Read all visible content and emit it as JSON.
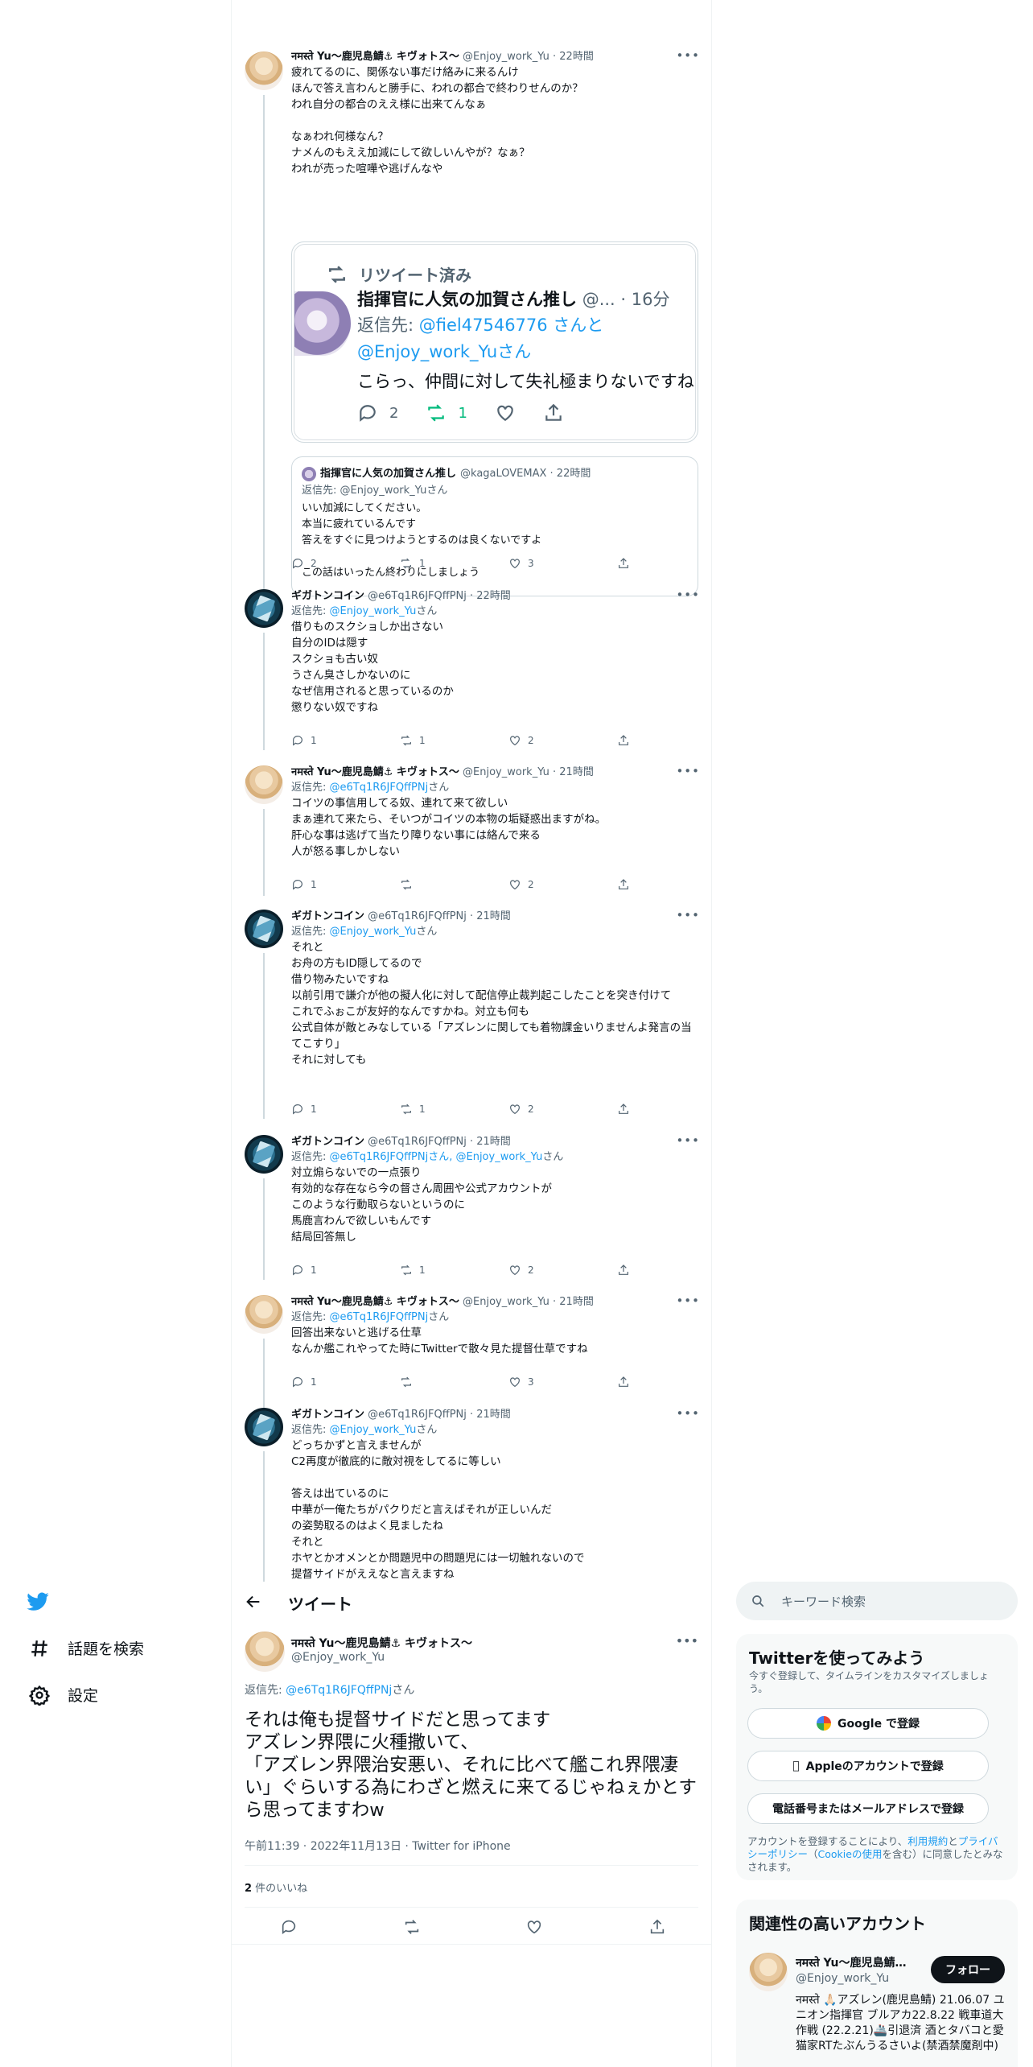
{
  "timeline": {
    "tweet1": {
      "name": "नमस्ते Yu〜鹿児島鯖⚓ キヴォトス〜",
      "handle": "@Enjoy_work_Yu · 22時間",
      "text": "疲れてるのに、関係ない事だけ絡みに来るんけ\nほんで答え言わんと勝手に、われの都合で終わりせんのか？\nわれ自分の都合のええ様に出来てんなぁ\n\nなぁわれ何様なん？\nナメんのもええ加減にして欲しいんやが？なぁ？\nわれが売った喧嘩や逃げんなや",
      "embed": {
        "retweet_label": "リツイート済み",
        "name": "指揮官に人気の加賀さん推し",
        "meta": "@... · 16分",
        "reply_to": "返信先: @fiel47546776 さんと @Enjoy_work_Yuさん",
        "reply_to_a": "返信先: ",
        "reply_to_b": "@fiel47546776 さんと @Enjoy_work_Yuさん",
        "text": "こらっ、仲間に対して失礼極まりないですね",
        "replies": "2",
        "retweets": "1"
      },
      "quote": {
        "name": "指揮官に人気の加賀さん推し",
        "handle": "@kagaLOVEMAX · 22時間",
        "reply_to": "返信先: @Enjoy_work_Yuさん",
        "text": "いい加減にしてください。\n本当に疲れているんです\n答えをすぐに見つけようとするのは良くないですよ\n\nこの話はいったん終わりにしましょう"
      },
      "replies": "2",
      "retweets": "1",
      "likes": "3"
    },
    "tweet2": {
      "name": "ギガトンコイン",
      "handle": "@e6Tq1R6JFQffPNj · 22時間",
      "reply_to_prefix": "返信先: ",
      "reply_to_link": "@Enjoy_work_Yu",
      "reply_to_suffix": "さん",
      "text": "借りものスクショしか出さない\n自分のIDは隠す\nスクショも古い奴\nうさん臭さしかないのに\nなぜ信用されると思っているのか\n懲りない奴ですね",
      "replies": "1",
      "retweets": "1",
      "likes": "2"
    },
    "tweet3": {
      "name": "नमस्ते Yu〜鹿児島鯖⚓ キヴォトス〜",
      "handle": "@Enjoy_work_Yu · 21時間",
      "reply_to_prefix": "返信先: ",
      "reply_to_link": "@e6Tq1R6JFQffPNj",
      "reply_to_suffix": "さん",
      "text": "コイツの事信用してる奴、連れて来て欲しい\nまぁ連れて来たら、そいつがコイツの本物の垢疑惑出ますがね。\n肝心な事は逃げて当たり障りない事には絡んで来る\n人が怒る事しかしない",
      "replies": "1",
      "retweets": "",
      "likes": "2"
    },
    "tweet4": {
      "name": "ギガトンコイン",
      "handle": "@e6Tq1R6JFQffPNj · 21時間",
      "reply_to_prefix": "返信先: ",
      "reply_to_link": "@Enjoy_work_Yu",
      "reply_to_suffix": "さん",
      "text": "それと\nお舟の方もID隠してるので\n借り物みたいですね\n以前引用で謙介が他の擬人化に対して配信停止裁判起こしたことを突き付けて\nこれでふぉこが友好的なんですかね。対立も何も\n公式自体が敵とみなしている「アズレンに関しても着物課金いりませんよ発言の当てこすり」\nそれに対しても",
      "replies": "1",
      "retweets": "1",
      "likes": "2"
    },
    "tweet5": {
      "name": "ギガトンコイン",
      "handle": "@e6Tq1R6JFQffPNj · 21時間",
      "reply_to_prefix": "返信先: ",
      "reply_to_link": "@e6Tq1R6JFQffPNjさん, @Enjoy_work_Yu",
      "reply_to_suffix": "さん",
      "text": "対立煽らないでの一点張り\n有効的な存在なら今の督さん周囲や公式アカウントが\nこのような行動取らないというのに\n馬鹿言わんで欲しいもんです\n結局回答無し",
      "replies": "1",
      "retweets": "1",
      "likes": "2"
    },
    "tweet6": {
      "name": "नमस्ते Yu〜鹿児島鯖⚓ キヴォトス〜",
      "handle": "@Enjoy_work_Yu · 21時間",
      "reply_to_prefix": "返信先: ",
      "reply_to_link": "@e6Tq1R6JFQffPNj",
      "reply_to_suffix": "さん",
      "text": "回答出来ないと逃げる仕草\nなんか艦これやってた時にTwitterで散々見た提督仕草ですね",
      "replies": "1",
      "retweets": "",
      "likes": "3"
    },
    "tweet7": {
      "name": "ギガトンコイン",
      "handle": "@e6Tq1R6JFQffPNj · 21時間",
      "reply_to_prefix": "返信先: ",
      "reply_to_link": "@Enjoy_work_Yu",
      "reply_to_suffix": "さん",
      "text": "どっちかずと言えませんが\nC2再度が徹底的に敵対視をしてるに等しい\n\n答えは出ているのに\n中華が一俺たちがパクりだと言えばそれが正しいんだ\nの姿勢取るのはよく見ましたね\nそれと\nホヤとかオメンとか問題児中の問題児には一切触れないので\n提督サイドがええなと言えますね"
    }
  },
  "nav": {
    "explore": "話題を検索",
    "settings": "設定"
  },
  "focus": {
    "title": "ツイート",
    "name": "नमस्ते Yu〜鹿児島鯖⚓ キヴォトス〜",
    "handle": "@Enjoy_work_Yu",
    "reply_to_prefix": "返信先: ",
    "reply_to_link": "@e6Tq1R6JFQffPNj",
    "reply_to_suffix": "さん",
    "text": "それは俺も提督サイドだと思ってます\nアズレン界隈に火種撒いて、\n「アズレン界隈治安悪い、それに比べて艦これ界隈凄い」ぐらいする為にわざと燃えに来てるじゃねぇかとすら思ってますわw",
    "meta": "午前11:39 · 2022年11月13日 · Twitter for iPhone",
    "likes_count": "2",
    "likes_label": " 件のいいね"
  },
  "sidebar": {
    "search_placeholder": "キーワード検索",
    "signup": {
      "title": "Twitterを使ってみよう",
      "subtitle": "今すぐ登録して、タイムラインをカスタマイズしましょう。",
      "google": "Google で登録",
      "apple": "Appleのアカウントで登録",
      "phone": "電話番号またはメールアドレスで登録",
      "legal_1": "アカウントを登録することにより、",
      "legal_terms": "利用規約",
      "legal_2": "と",
      "legal_privacy": "プライバシーポリシー",
      "legal_3": "（",
      "legal_cookie": "Cookieの使用",
      "legal_4": "を含む）に同意したとみなされます。"
    },
    "related": {
      "title": "関連性の高いアカウント",
      "name": "नमस्ते Yu〜鹿児島鯖⚓ キヴォトス〜",
      "handle": "@Enjoy_work_Yu",
      "follow": "フォロー",
      "bio": "नमस्ते 🙏🏻アズレン(鹿児島鯖) 21.06.07 ユニオン指揮官 ブルアカ22.8.22 戦車道大作戦 (22.2.21)🚢引退済 酒とタバコと愛猫家RTたぶんうるさいよ(禁酒禁魔剤中)"
    }
  },
  "colors": {
    "accent": "#1d9bf0",
    "retweet": "#00ba7c",
    "text": "#0f1419",
    "muted": "#536471"
  }
}
